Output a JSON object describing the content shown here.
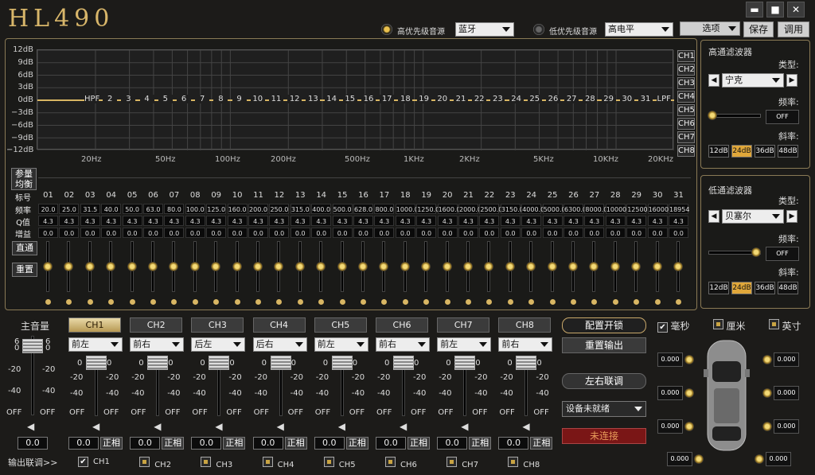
{
  "app": {
    "title": "HL490"
  },
  "window": {
    "minimize": "▬",
    "maximize": "■",
    "close": "✕"
  },
  "topbar": {
    "high_priority_label": "高优先级音源",
    "high_priority_value": "蓝牙",
    "low_priority_label": "低优先级音源",
    "low_priority_value": "高电平",
    "options": "选项",
    "save": "保存",
    "load": "调用"
  },
  "graph": {
    "y_labels": [
      "12dB",
      "9dB",
      "6dB",
      "3dB",
      "0dB",
      "−3dB",
      "−6dB",
      "−9dB",
      "−12dB"
    ],
    "x_labels": [
      "20Hz",
      "50Hz",
      "100Hz",
      "200Hz",
      "500Hz",
      "1KHz",
      "2KHz",
      "5KHz",
      "10KHz",
      "20KHz"
    ],
    "band_markers": [
      "HPF",
      "2",
      "3",
      "4",
      "5",
      "6",
      "7",
      "8",
      "9",
      "10",
      "11",
      "12",
      "13",
      "14",
      "15",
      "16",
      "17",
      "18",
      "19",
      "20",
      "21",
      "22",
      "23",
      "24",
      "25",
      "26",
      "27",
      "28",
      "29",
      "30",
      "31",
      "LPF"
    ],
    "channels": [
      "CH1",
      "CH2",
      "CH3",
      "CH4",
      "CH5",
      "CH6",
      "CH7",
      "CH8"
    ]
  },
  "peq": {
    "mode_btn": "参量",
    "eq_btn": "均衡",
    "bypass_btn": "直通",
    "reset_btn": "重置",
    "row_labels": {
      "band": "标号",
      "freq": "频率",
      "q": "Q值",
      "gain": "增益"
    },
    "bands": [
      "01",
      "02",
      "03",
      "04",
      "05",
      "06",
      "07",
      "08",
      "09",
      "10",
      "11",
      "12",
      "13",
      "14",
      "15",
      "16",
      "17",
      "18",
      "19",
      "20",
      "21",
      "22",
      "23",
      "24",
      "25",
      "26",
      "27",
      "28",
      "29",
      "30",
      "31"
    ],
    "freqs": [
      "20.0",
      "25.0",
      "31.5",
      "40.0",
      "50.0",
      "63.0",
      "80.0",
      "100.0",
      "125.0",
      "160.0",
      "200.0",
      "250.0",
      "315.0",
      "400.0",
      "500.0",
      "628.0",
      "800.0",
      "1000.0",
      "1250.0",
      "1600.0",
      "2000.0",
      "2500.0",
      "3150.0",
      "4000.0",
      "5000.0",
      "6300.0",
      "8000.0",
      "10000",
      "12500",
      "16000",
      "18954"
    ],
    "q": "4.3",
    "gain": "0.0"
  },
  "hpf": {
    "title": "高通滤波器",
    "type_label": "类型:",
    "type_value": "宁克",
    "freq_label": "频率:",
    "freq_value": "OFF",
    "slope_label": "斜率:",
    "slopes": [
      "12dB",
      "24dB",
      "36dB",
      "48dB"
    ]
  },
  "lpf": {
    "title": "低通滤波器",
    "type_label": "类型:",
    "type_value": "贝塞尔",
    "freq_label": "频率:",
    "freq_value": "OFF",
    "slope_label": "斜率:",
    "slopes": [
      "12dB",
      "24dB",
      "36dB",
      "48dB"
    ]
  },
  "master": {
    "label": "主音量",
    "value": "0.0",
    "scale_top": "6",
    "scale_0": "0",
    "scale_20": "-20",
    "scale_40": "-40",
    "scale_off": "OFF"
  },
  "channels": [
    {
      "tab": "CH1",
      "pos": "前左",
      "value": "0.0",
      "phase": "正相"
    },
    {
      "tab": "CH2",
      "pos": "前右",
      "value": "0.0",
      "phase": "正相"
    },
    {
      "tab": "CH3",
      "pos": "后左",
      "value": "0.0",
      "phase": "正相"
    },
    {
      "tab": "CH4",
      "pos": "后右",
      "value": "0.0",
      "phase": "正相"
    },
    {
      "tab": "CH5",
      "pos": "前左",
      "value": "0.0",
      "phase": "正相"
    },
    {
      "tab": "CH6",
      "pos": "前右",
      "value": "0.0",
      "phase": "正相"
    },
    {
      "tab": "CH7",
      "pos": "前左",
      "value": "0.0",
      "phase": "正相"
    },
    {
      "tab": "CH8",
      "pos": "前右",
      "value": "0.0",
      "phase": "正相"
    }
  ],
  "fader_scale": {
    "s0": "0",
    "s20": "-20",
    "s40": "-40",
    "off": "OFF"
  },
  "link": {
    "label": "输出联调>>",
    "items": [
      "CH1",
      "CH2",
      "CH3",
      "CH4",
      "CH5",
      "CH6",
      "CH7",
      "CH8"
    ]
  },
  "config": {
    "lock": "配置开锁",
    "reset_out": "重置输出",
    "lr_link": "左右联调",
    "device": "设备未就绪",
    "status": "未连接"
  },
  "delay": {
    "units": [
      "毫秒",
      "厘米",
      "英寸"
    ],
    "value": "0.000"
  }
}
